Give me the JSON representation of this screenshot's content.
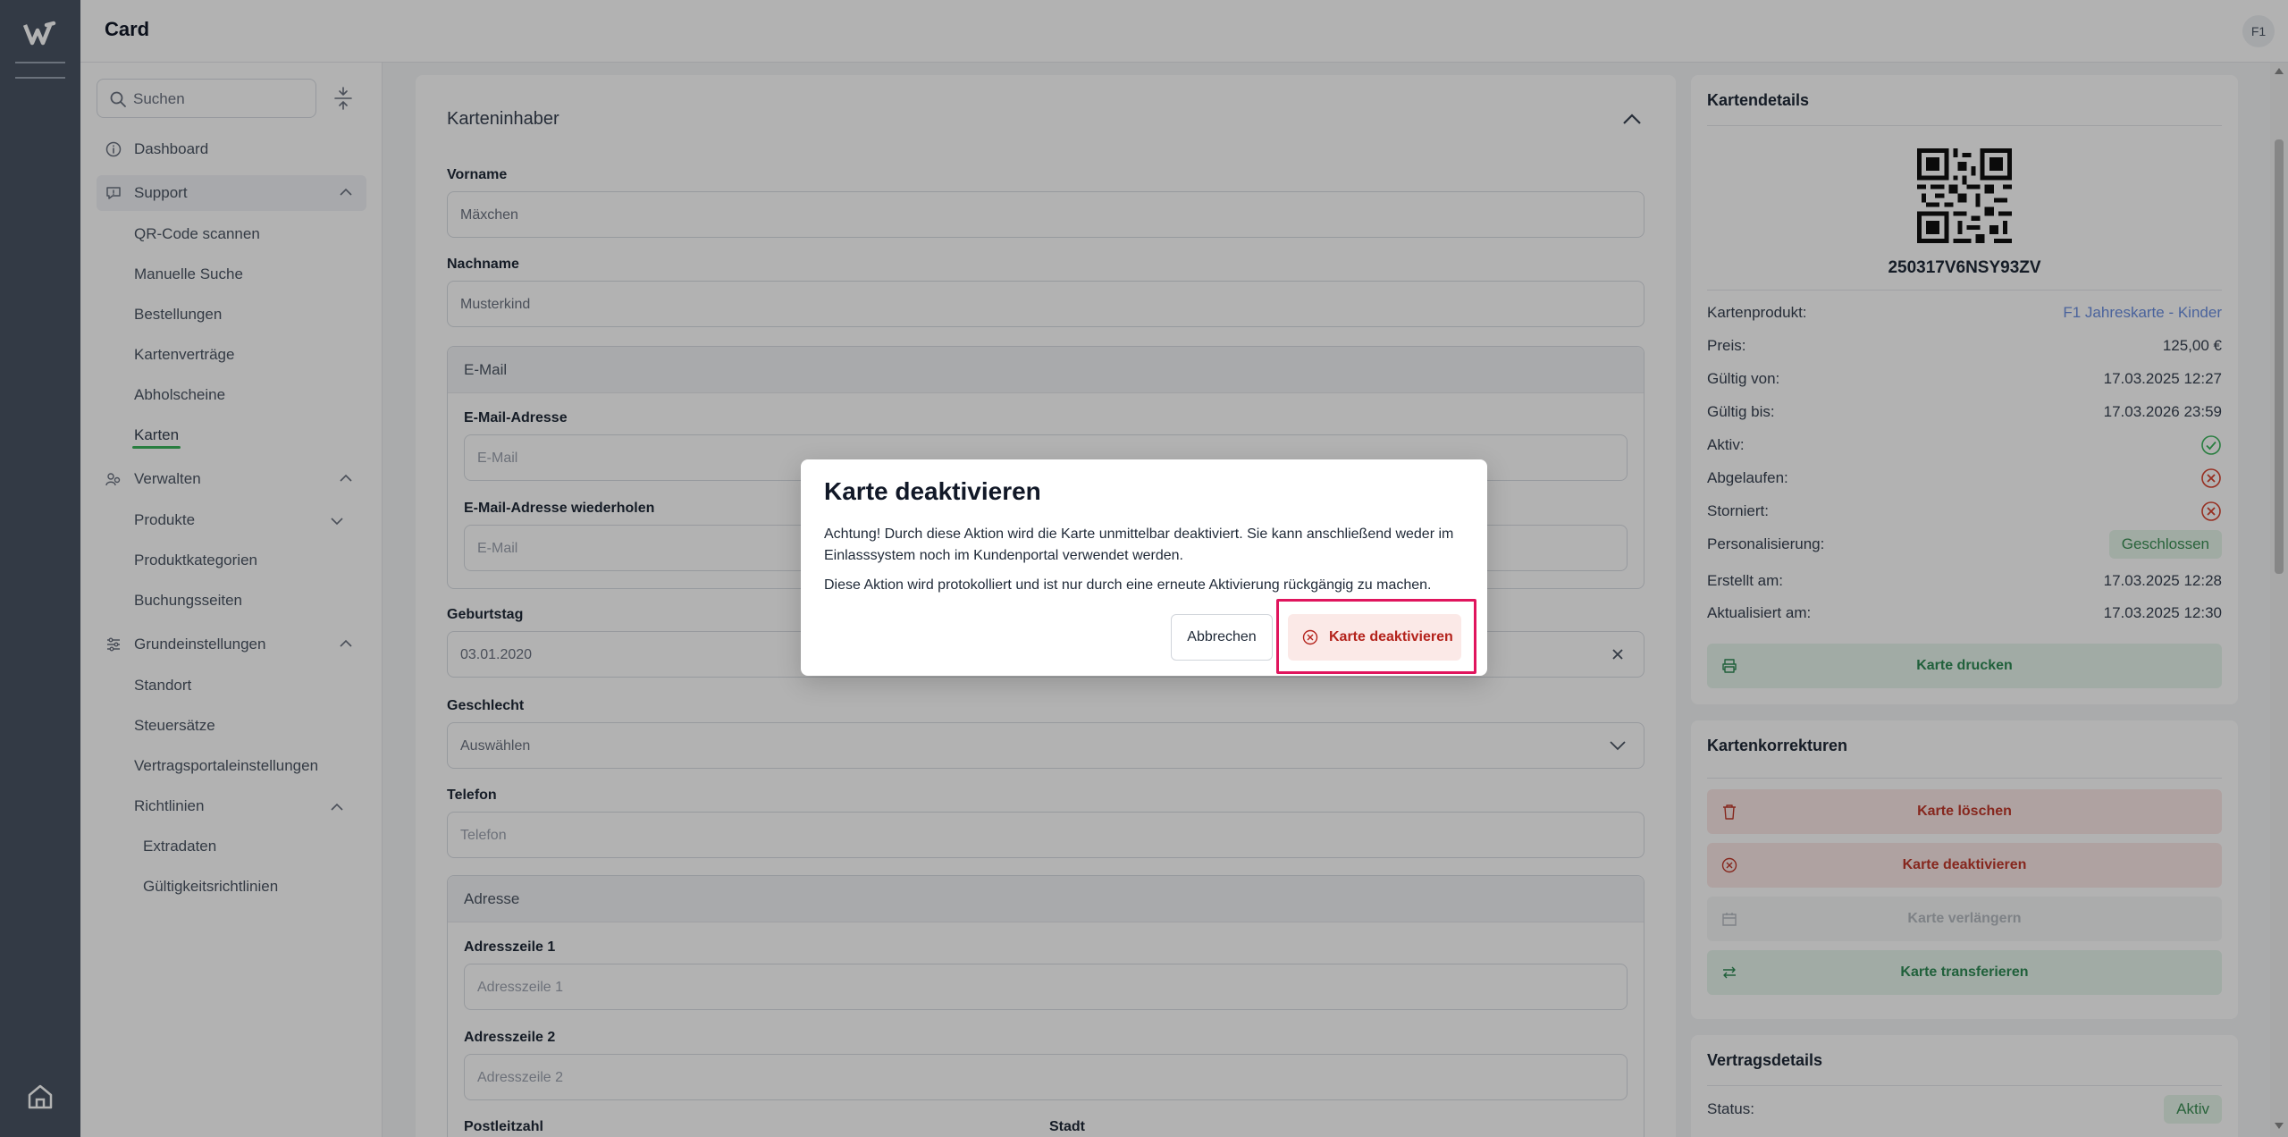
{
  "app": {
    "title": "Card",
    "avatar": "F1"
  },
  "sidebar": {
    "search_placeholder": "Suchen",
    "items": [
      {
        "label": "Dashboard",
        "icon": "info-circle-icon"
      },
      {
        "label": "Support",
        "icon": "chat-icon"
      },
      {
        "label": "Verwalten",
        "icon": "people-icon"
      },
      {
        "label": "Grundeinstellungen",
        "icon": "sliders-icon"
      }
    ],
    "support_sub": [
      "QR-Code scannen",
      "Manuelle Suche",
      "Bestellungen",
      "Kartenverträge",
      "Abholscheine",
      "Karten"
    ],
    "verwalten_sub": [
      "Produkte",
      "Produktkategorien",
      "Buchungsseiten"
    ],
    "grund_sub": [
      "Standort",
      "Steuersätze",
      "Vertragsportaleinstellungen",
      "Richtlinien"
    ],
    "richtlinien_sub": [
      "Extradaten",
      "Gültigkeitsrichtlinien"
    ]
  },
  "form": {
    "section_title": "Karteninhaber",
    "vorname_label": "Vorname",
    "vorname_value": "Mäxchen",
    "nachname_label": "Nachname",
    "nachname_value": "Musterkind",
    "email_group": "E-Mail",
    "email_label": "E-Mail-Adresse",
    "email_placeholder": "E-Mail",
    "email_repeat_label": "E-Mail-Adresse wiederholen",
    "email_repeat_placeholder": "E-Mail",
    "geburtstag_label": "Geburtstag",
    "geburtstag_value": "03.01.2020",
    "geschlecht_label": "Geschlecht",
    "geschlecht_value": "Auswählen",
    "telefon_label": "Telefon",
    "telefon_placeholder": "Telefon",
    "adresse_group": "Adresse",
    "adresse1_label": "Adresszeile 1",
    "adresse1_placeholder": "Adresszeile 1",
    "adresse2_label": "Adresszeile 2",
    "adresse2_placeholder": "Adresszeile 2",
    "plz_label": "Postleitzahl",
    "stadt_label": "Stadt"
  },
  "details": {
    "title": "Kartendetails",
    "card_number": "250317V6NSY93ZV",
    "rows": [
      {
        "key": "Kartenprodukt:",
        "value": "F1 Jahreskarte - Kinder"
      },
      {
        "key": "Preis:",
        "value": "125,00 €"
      },
      {
        "key": "Gültig von:",
        "value": "17.03.2025 12:27"
      },
      {
        "key": "Gültig bis:",
        "value": "17.03.2026 23:59"
      },
      {
        "key": "Aktiv:",
        "value": ""
      },
      {
        "key": "Abgelaufen:",
        "value": ""
      },
      {
        "key": "Storniert:",
        "value": ""
      },
      {
        "key": "Personalisierung:",
        "value": "Geschlossen"
      },
      {
        "key": "Erstellt am:",
        "value": "17.03.2025 12:28"
      },
      {
        "key": "Aktualisiert am:",
        "value": "17.03.2025 12:30"
      }
    ],
    "print_button": "Karte drucken"
  },
  "corrections": {
    "title": "Kartenkorrekturen",
    "delete": "Karte löschen",
    "deactivate": "Karte deaktivieren",
    "extend": "Karte verlängern",
    "transfer": "Karte transferieren"
  },
  "contract": {
    "title": "Vertragsdetails",
    "status_key": "Status:",
    "status_value": "Aktiv"
  },
  "modal": {
    "title": "Karte deaktivieren",
    "text1": "Achtung! Durch diese Aktion wird die Karte unmittelbar deaktiviert. Sie kann anschließend weder im Einlasssystem noch im Kundenportal verwendet werden.",
    "text2": "Diese Aktion wird protokolliert und ist nur durch eine erneute Aktivierung rückgängig zu machen.",
    "cancel": "Abbrechen",
    "confirm": "Karte deaktivieren"
  },
  "colors": {
    "rail": "#495463",
    "success": "#3cb55c",
    "danger": "#c0392b",
    "link": "#6b8fe0",
    "highlight": "#e0155d"
  }
}
